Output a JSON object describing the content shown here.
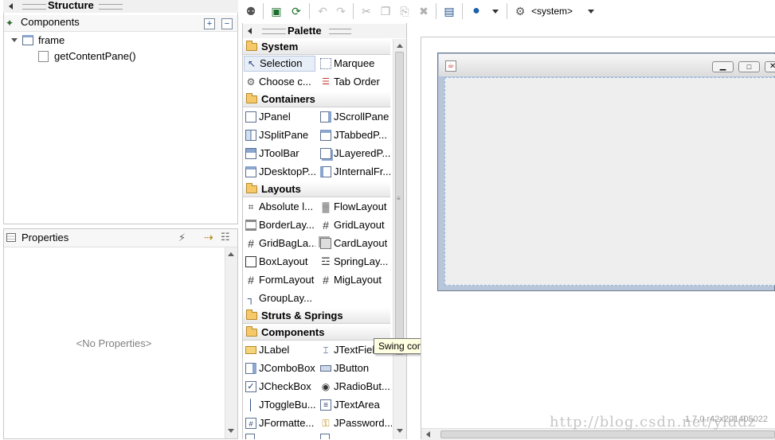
{
  "structure": {
    "title": "Structure",
    "components_label": "Components",
    "tree": [
      {
        "label": "frame"
      },
      {
        "label": "getContentPane()"
      }
    ]
  },
  "properties": {
    "title": "Properties",
    "empty_text": "<No Properties>"
  },
  "toolbar": {
    "system_label": "<system>"
  },
  "palette": {
    "title": "Palette",
    "categories": [
      {
        "name": "System",
        "items": [
          "Selection",
          "Marquee",
          "Choose c...",
          "Tab Order"
        ]
      },
      {
        "name": "Containers",
        "items": [
          "JPanel",
          "JScrollPane",
          "JSplitPane",
          "JTabbedP...",
          "JToolBar",
          "JLayeredP...",
          "JDesktopP...",
          "JInternalFr..."
        ]
      },
      {
        "name": "Layouts",
        "items": [
          "Absolute l...",
          "FlowLayout",
          "BorderLay...",
          "GridLayout",
          "GridBagLa...",
          "CardLayout",
          "BoxLayout",
          "SpringLay...",
          "FormLayout",
          "MigLayout",
          "GroupLay..."
        ]
      },
      {
        "name": "Struts & Springs",
        "items": []
      },
      {
        "name": "Components",
        "items": [
          "JLabel",
          "JTextFiel",
          "JComboBox",
          "JButton",
          "JCheckBox",
          "JRadioBut...",
          "JToggleBu...",
          "JTextArea",
          "JFormatte...",
          "JPassword..."
        ]
      }
    ]
  },
  "tooltip": "Swing components",
  "watermark": "http://blog.csdn.net/ylddz",
  "version_text": "1.7.0.r42x201405022"
}
